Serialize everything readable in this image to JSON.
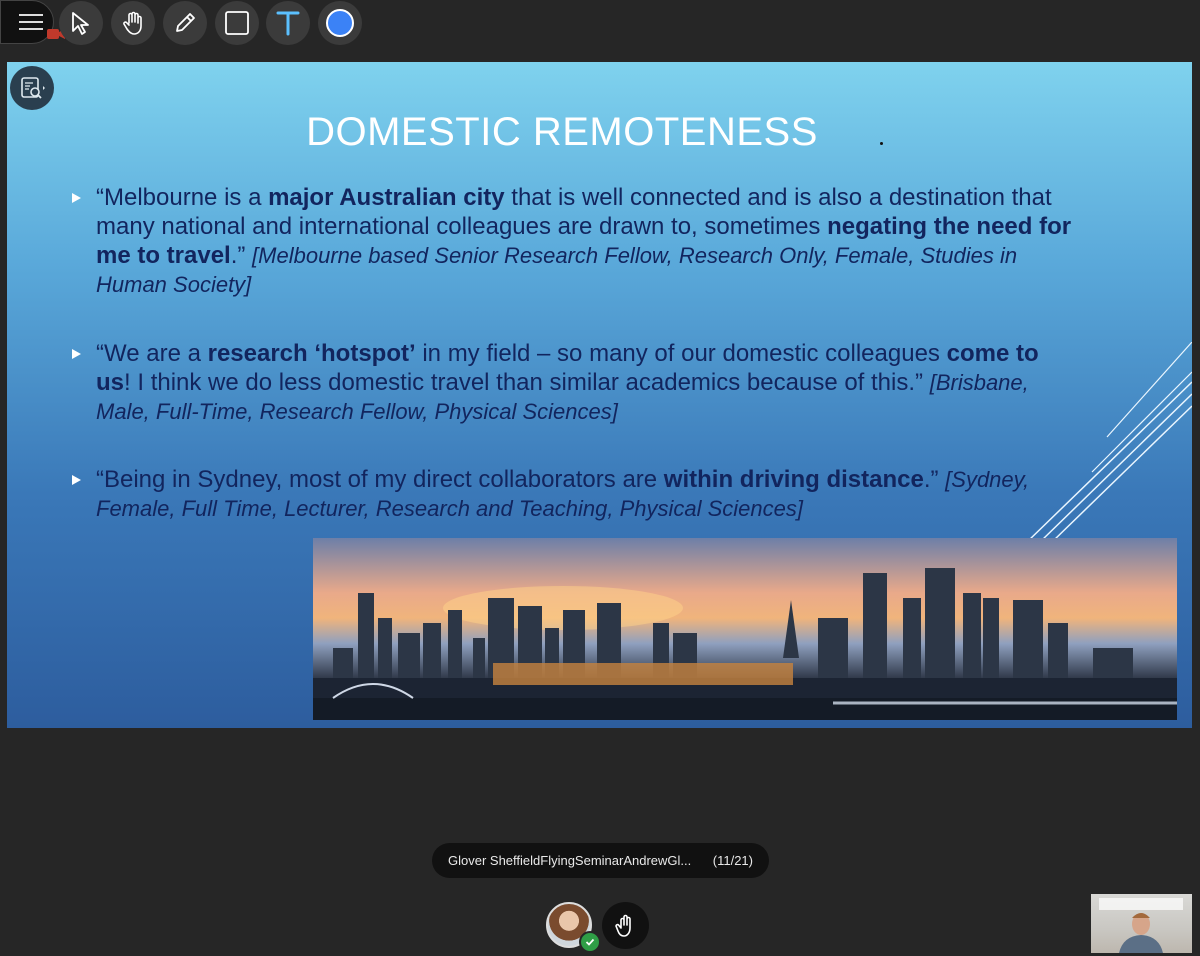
{
  "toolbar": {
    "tools": [
      {
        "icon": "menu-icon"
      },
      {
        "icon": "pointer-icon"
      },
      {
        "icon": "hand-icon"
      },
      {
        "icon": "pencil-icon"
      },
      {
        "icon": "rectangle-icon"
      },
      {
        "icon": "text-icon",
        "color": "#5bc0ff"
      },
      {
        "icon": "color-dot-icon",
        "color": "#3b82f6"
      }
    ]
  },
  "slide": {
    "title": "DOMESTIC REMOTENESS",
    "bullets": [
      {
        "parts": [
          {
            "t": "“Melbourne is a "
          },
          {
            "t": "major Australian city",
            "b": true
          },
          {
            "t": " that is well connected and is also a destination that many national and international colleagues are drawn to, sometimes "
          },
          {
            "t": "negating the need for me to travel",
            "b": true
          },
          {
            "t": ".” "
          },
          {
            "t": "[Melbourne based Senior Research Fellow, Research Only, Female, Studies in Human Society]",
            "i": true
          }
        ]
      },
      {
        "parts": [
          {
            "t": "“We are a "
          },
          {
            "t": "research ‘hotspot’",
            "b": true
          },
          {
            "t": " in my field – so many of our domestic colleagues "
          },
          {
            "t": "come to us",
            "b": true
          },
          {
            "t": "! I think we do less domestic travel than similar academics because of this.” "
          },
          {
            "t": "[Brisbane, Male, Full-Time, Research Fellow, Physical Sciences]",
            "i": true
          }
        ]
      },
      {
        "parts": [
          {
            "t": "“Being in Sydney, most of my direct collaborators are "
          },
          {
            "t": "within driving distance",
            "b": true
          },
          {
            "t": ".” "
          },
          {
            "t": "[Sydney, Female, Full Time, Lecturer, Research and Teaching, Physical Sciences]",
            "i": true
          }
        ]
      }
    ],
    "colors": {
      "text": "#12255e",
      "title": "#ffffff"
    }
  },
  "bottom": {
    "document_name": "Glover SheffieldFlyingSeminarAndrewGl...",
    "page_indicator": "(11/21)"
  }
}
